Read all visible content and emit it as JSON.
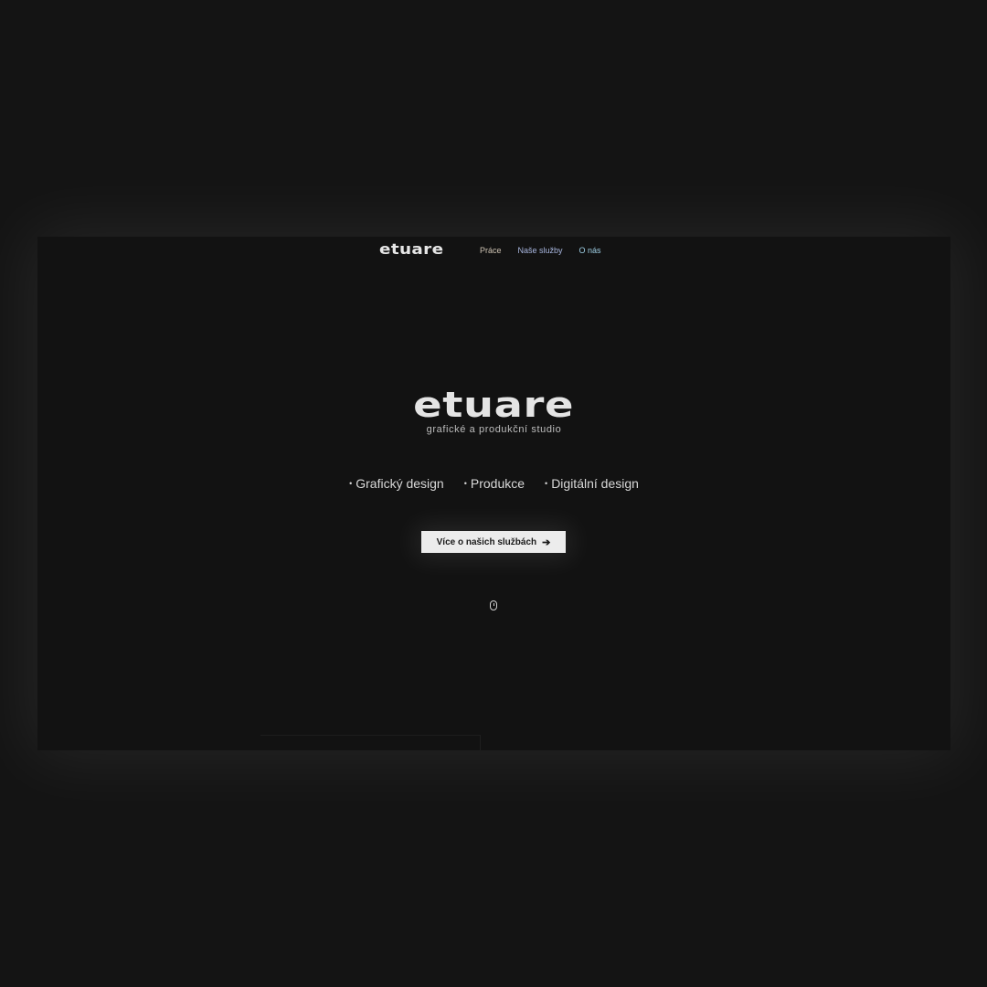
{
  "nav": {
    "logo": "etuare",
    "links": [
      {
        "label": "Práce"
      },
      {
        "label": "Naše služby"
      },
      {
        "label": "O nás"
      }
    ]
  },
  "hero": {
    "title": "etuare",
    "subtitle": "grafické a produkční studio",
    "services": [
      "Grafický design",
      "Produkce",
      "Digitální design"
    ],
    "cta_label": "Více o našich službách",
    "cta_icon": "arrow-right-icon",
    "scroll_icon": "mouse-scroll-icon"
  },
  "colors": {
    "background": "#141414",
    "panel": "#121212",
    "text": "#e4e4e4",
    "button_bg": "#ececec"
  }
}
